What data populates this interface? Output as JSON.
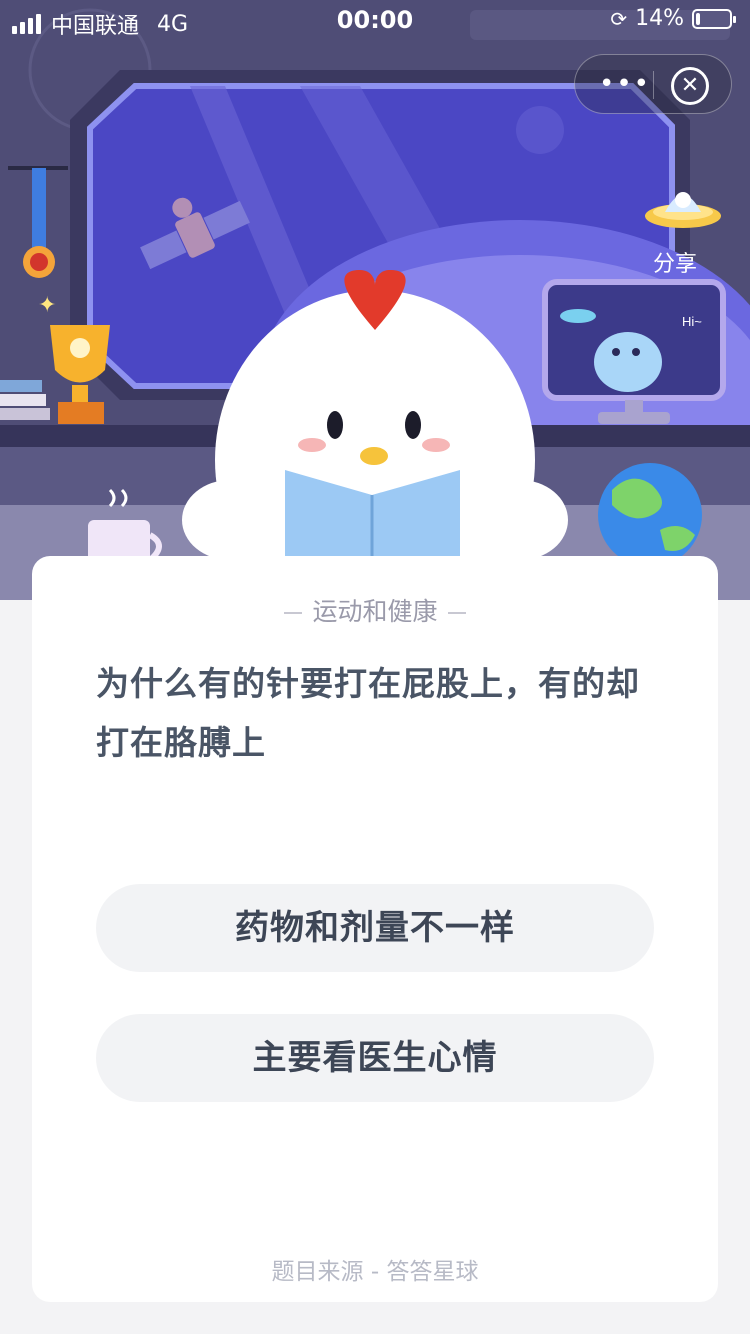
{
  "status_bar": {
    "carrier": "中国联通",
    "network": "4G",
    "time": "00:00",
    "battery_percent": "14%",
    "battery_level": 0.14
  },
  "capsule": {
    "more_label": "•••",
    "close_label": "✕"
  },
  "share": {
    "label": "分享"
  },
  "scene": {
    "monitor_text": "Hi~"
  },
  "quiz": {
    "category": "运动和健康",
    "question": "为什么有的针要打在屁股上，有的却打在胳膊上",
    "options": [
      {
        "label": "药物和剂量不一样"
      },
      {
        "label": "主要看医生心情"
      }
    ],
    "source": "题目来源 - 答答星球"
  },
  "colors": {
    "scene_bg": "#4e4c74",
    "window_glass": "#4b47c4",
    "card_bg": "#ffffff",
    "option_bg": "#f2f3f5",
    "question_text": "#4a5566"
  }
}
